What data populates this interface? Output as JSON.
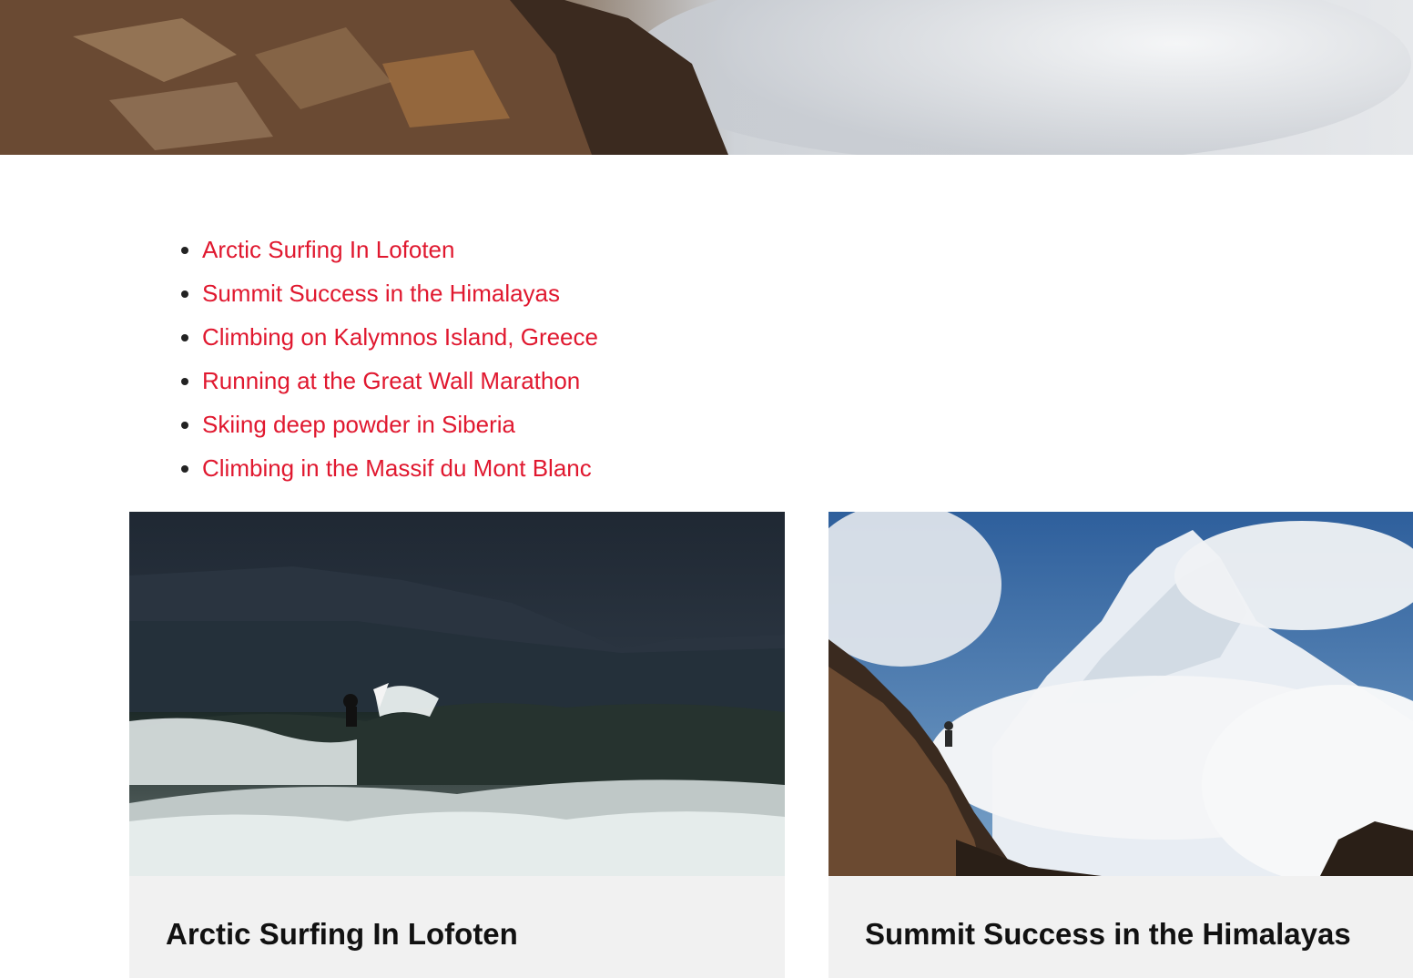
{
  "hero": {
    "image_name": "mountain-clouds-hero-image"
  },
  "story_links": [
    {
      "label": "Arctic Surfing In Lofoten"
    },
    {
      "label": "Summit Success in the Himalayas"
    },
    {
      "label": "Climbing on Kalymnos Island, Greece"
    },
    {
      "label": "Running at the Great Wall Marathon"
    },
    {
      "label": "Skiing deep powder in Siberia"
    },
    {
      "label": "Climbing in the Massif du Mont Blanc"
    }
  ],
  "cards": [
    {
      "title": "Arctic Surfing In Lofoten",
      "image_name": "arctic-surf-image"
    },
    {
      "title": "Summit Success in the Himalayas",
      "image_name": "himalaya-summit-image"
    }
  ],
  "colors": {
    "link": "#e0182f",
    "card_bg": "#f1f1f1",
    "title_text": "#111111"
  }
}
